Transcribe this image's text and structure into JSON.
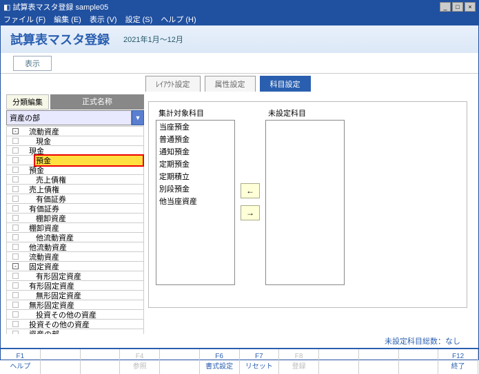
{
  "window": {
    "title": "試算表マスタ登録 sample05"
  },
  "menu": {
    "file": "ファイル (F)",
    "edit": "編集 (E)",
    "view": "表示 (V)",
    "settings": "設定 (S)",
    "help": "ヘルプ (H)"
  },
  "header": {
    "title": "試算表マスタ登録",
    "period": "2021年1月～12月"
  },
  "toolbar": {
    "display": "表示"
  },
  "tabs": {
    "layout": "ﾚｲｱｳﾄ設定",
    "attr": "属性設定",
    "account": "科目設定"
  },
  "left": {
    "edit_btn": "分類編集",
    "name_header": "正式名称",
    "combo_value": "資産の部",
    "tree": [
      {
        "indent": 1,
        "node": "-",
        "label": "流動資産"
      },
      {
        "indent": 2,
        "node": "",
        "label": "現金"
      },
      {
        "indent": 1,
        "node": "",
        "label": "現金"
      },
      {
        "indent": 2,
        "node": "",
        "label": "預金",
        "hl": "both"
      },
      {
        "indent": 1,
        "node": "",
        "label": "預金"
      },
      {
        "indent": 2,
        "node": "",
        "label": "売上債権"
      },
      {
        "indent": 1,
        "node": "",
        "label": "売上債権"
      },
      {
        "indent": 2,
        "node": "",
        "label": "有価証券"
      },
      {
        "indent": 1,
        "node": "",
        "label": "有価証券"
      },
      {
        "indent": 2,
        "node": "",
        "label": "棚卸資産"
      },
      {
        "indent": 1,
        "node": "",
        "label": "棚卸資産"
      },
      {
        "indent": 2,
        "node": "",
        "label": "他流動資産"
      },
      {
        "indent": 1,
        "node": "",
        "label": "他流動資産"
      },
      {
        "indent": 1,
        "node": "",
        "label": "流動資産"
      },
      {
        "indent": 1,
        "node": "-",
        "label": "固定資産"
      },
      {
        "indent": 2,
        "node": "",
        "label": "有形固定資産"
      },
      {
        "indent": 1,
        "node": "",
        "label": "有形固定資産"
      },
      {
        "indent": 2,
        "node": "",
        "label": "無形固定資産"
      },
      {
        "indent": 1,
        "node": "",
        "label": "無形固定資産"
      },
      {
        "indent": 2,
        "node": "",
        "label": "投資その他の資産"
      },
      {
        "indent": 1,
        "node": "",
        "label": "投資その他の資産"
      },
      {
        "indent": 1,
        "node": "",
        "label": "資産の部"
      }
    ]
  },
  "right": {
    "target_label": "集計対象科目",
    "unset_label": "未設定科目",
    "targets": [
      "当座預金",
      "普通預金",
      "通知預金",
      "定期預金",
      "定期積立",
      "別段預金",
      "他当座資産"
    ],
    "unset": [],
    "arrow_left": "←",
    "arrow_right": "→"
  },
  "footer": {
    "status": "未設定科目総数：なし"
  },
  "fnkeys": {
    "f1": {
      "key": "F1",
      "label": "ヘルプ"
    },
    "f4": {
      "key": "F4",
      "label": "参照"
    },
    "f6": {
      "key": "F6",
      "label": "書式設定"
    },
    "f7": {
      "key": "F7",
      "label": "リセット"
    },
    "f8": {
      "key": "F8",
      "label": "登録"
    },
    "f12": {
      "key": "F12",
      "label": "終了"
    }
  }
}
